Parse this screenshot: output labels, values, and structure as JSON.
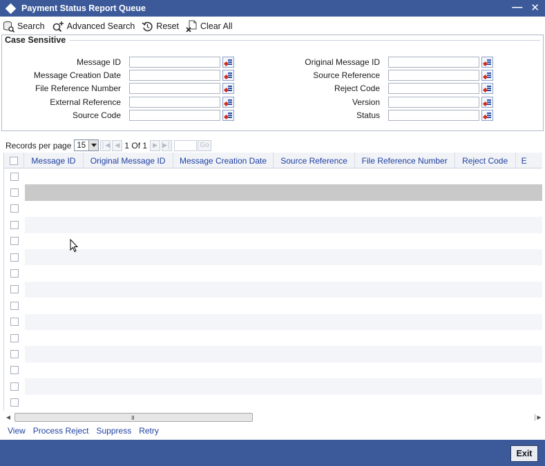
{
  "window": {
    "title": "Payment Status Report Queue",
    "minimize_glyph": "—",
    "close_glyph": "✕"
  },
  "toolbar": {
    "search": "Search",
    "advanced_search": "Advanced Search",
    "reset": "Reset",
    "clear_all": "Clear All"
  },
  "criteria": {
    "section_title": "Case Sensitive",
    "left_fields": [
      {
        "label": "Message ID",
        "value": ""
      },
      {
        "label": "Message Creation Date",
        "value": ""
      },
      {
        "label": "File Reference Number",
        "value": ""
      },
      {
        "label": "External Reference",
        "value": ""
      },
      {
        "label": "Source Code",
        "value": ""
      }
    ],
    "right_fields": [
      {
        "label": "Original Message ID",
        "value": ""
      },
      {
        "label": "Source Reference",
        "value": ""
      },
      {
        "label": "Reject Code",
        "value": ""
      },
      {
        "label": "Version",
        "value": ""
      },
      {
        "label": "Status",
        "value": ""
      }
    ]
  },
  "pager": {
    "records_label": "Records per page",
    "records_value": "15",
    "page_info": "1 Of 1",
    "go_label": "Go"
  },
  "grid": {
    "columns": [
      "Message ID",
      "Original Message ID",
      "Message Creation Date",
      "Source Reference",
      "File Reference Number",
      "Reject Code",
      "E"
    ],
    "row_count": 15
  },
  "actions": {
    "view": "View",
    "process_reject": "Process Reject",
    "suppress": "Suppress",
    "retry": "Retry"
  },
  "footer": {
    "exit": "Exit"
  },
  "icons": {
    "title": "diamond-icon",
    "search": "search-icon",
    "advanced_search": "advanced-search-icon",
    "reset": "reset-icon",
    "clear_all": "clear-all-icon",
    "lov": "list-of-values-icon"
  },
  "colors": {
    "titlebar": "#3c5a9a",
    "link": "#1d3fa0",
    "selected_row": "#c9c9c9"
  }
}
